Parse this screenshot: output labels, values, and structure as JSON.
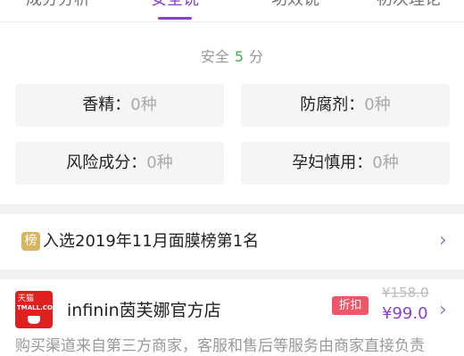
{
  "tabs": [
    {
      "label": "成分分析",
      "active": false
    },
    {
      "label": "安全说",
      "active": true
    },
    {
      "label": "功效说",
      "active": false
    },
    {
      "label": "初次理论",
      "active": false
    }
  ],
  "safety": {
    "label": "安全",
    "score": "5",
    "unit": "分"
  },
  "ingredients": [
    {
      "name": "香精",
      "sep": "：",
      "value": "0种"
    },
    {
      "name": "防腐剂",
      "sep": "：",
      "value": "0种"
    },
    {
      "name": "风险成分",
      "sep": "：",
      "value": "0种"
    },
    {
      "name": "孕妇慎用",
      "sep": "：",
      "value": "0种"
    }
  ],
  "ranking": {
    "badge": "榜",
    "text": "入选2019年11月面膜榜第1名",
    "chevron": "›"
  },
  "store": {
    "logo_top": "天猫",
    "logo_bottom": "TMALL.COM",
    "name": "infinin茵芙娜官方店",
    "discount_badge": "折扣",
    "original_price": "¥158.0",
    "price": "¥99.0",
    "chevron": "›"
  },
  "disclaimer": "购买渠道来自第三方商家，客服和售后等服务由商家直接负责",
  "colors": {
    "accent": "#8a3fd0",
    "score_green": "#3db34d",
    "discount_red": "#f0566a",
    "tmall_red": "#e02020"
  }
}
